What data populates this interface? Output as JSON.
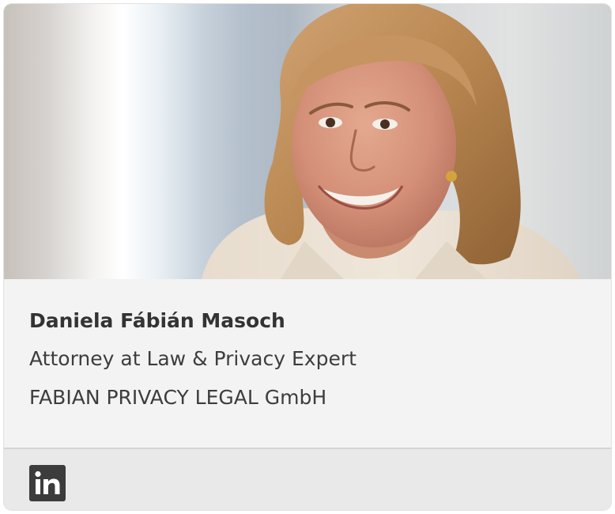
{
  "profile": {
    "name": "Daniela Fábián Masoch",
    "role": "Attorney at Law & Privacy Expert",
    "company": "FABIAN PRIVACY LEGAL GmbH"
  },
  "social": {
    "icon": "linkedin-icon"
  },
  "colors": {
    "card_background": "#f3f3f3",
    "footer_background": "#e9e9e9",
    "text": "#333333",
    "icon": "#3c3c3c"
  }
}
